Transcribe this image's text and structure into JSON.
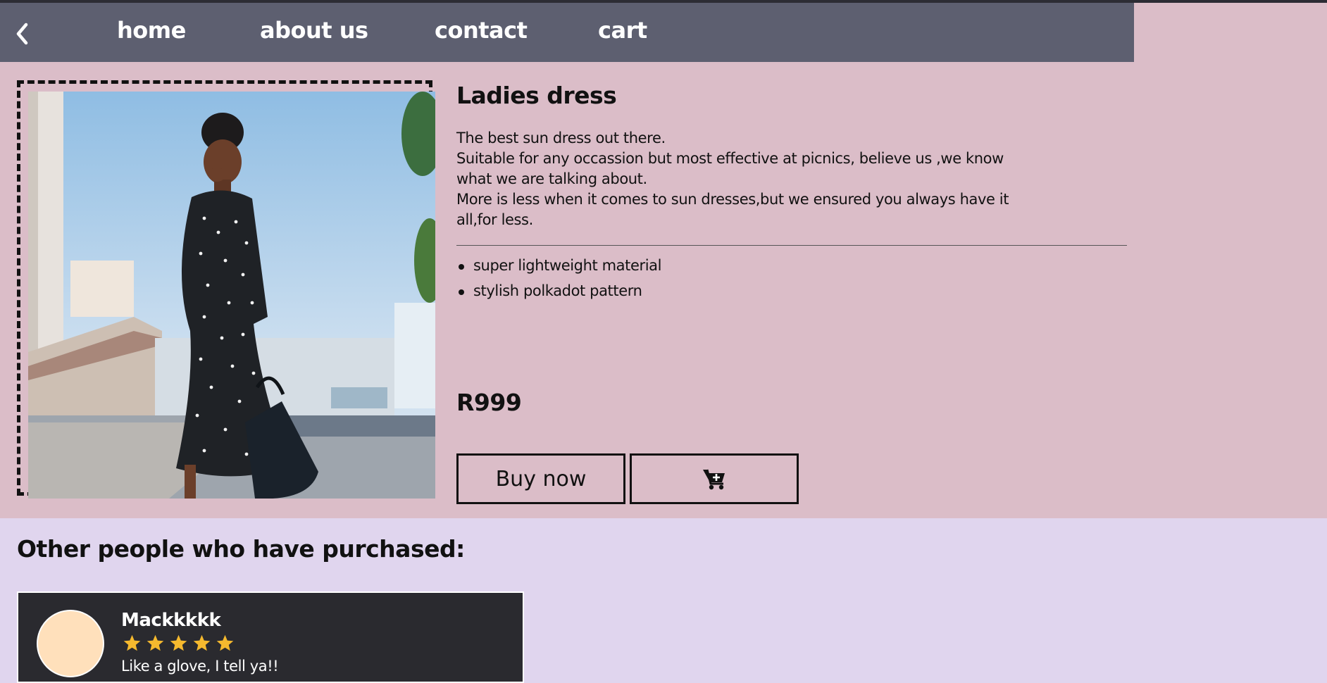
{
  "nav": {
    "back_icon": "chevron-left-icon",
    "links": [
      "home",
      "about us",
      "contact",
      "cart"
    ]
  },
  "product": {
    "title": "Ladies dress",
    "description_lines": [
      "The best sun dress out there.",
      "Suitable for any occassion but most effective at picnics, believe us ,we know",
      "what we are talking about.",
      "More is less when it comes to sun dresses,but we ensured you always have it",
      "all,for less."
    ],
    "features": [
      "super lightweight material",
      "stylish polkadot pattern"
    ],
    "price": "R999",
    "buy_label": "Buy now",
    "cart_icon": "cart-plus-icon"
  },
  "others": {
    "title": "Other people who have purchased:",
    "reviews": [
      {
        "name": "Mackkkkk",
        "rating": 5,
        "text": "Like a glove, I tell ya!!"
      }
    ]
  },
  "colors": {
    "nav_bg": "#5d5f70",
    "product_bg": "#dbbdc8",
    "page_bg": "#e0d5ee",
    "card_bg": "#2a2a2f",
    "star": "#f5b92e",
    "avatar": "#ffe0bb"
  }
}
